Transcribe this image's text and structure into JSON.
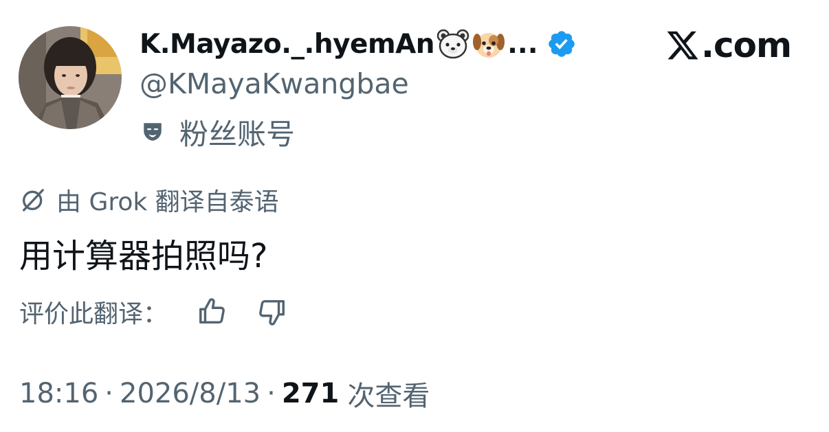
{
  "author": {
    "display_name": "K.Mayazo._.hyemAn",
    "name_emojis": [
      "polar-bear-face",
      "dog-face"
    ],
    "ellipsis": "...",
    "verified": true,
    "handle": "@KMayaKwangbae",
    "account_label": "粉丝账号"
  },
  "brand": {
    "label": ".com"
  },
  "translation": {
    "label": "由 Grok 翻译自泰语"
  },
  "tweet": {
    "text": "用计算器拍照吗?"
  },
  "rating": {
    "label": "评价此翻译："
  },
  "meta": {
    "time": "18:16",
    "date": "2026/8/13",
    "separator": "·",
    "views_count": "271",
    "views_label": "次查看"
  },
  "colors": {
    "primary_text": "#0f1419",
    "secondary_text": "#536471",
    "verified_blue": "#1d9bf0",
    "background": "#ffffff"
  },
  "icons": {
    "verified": "verified-badge-icon",
    "account_label": "theater-mask-icon",
    "translation": "grok-icon",
    "like_translation": "thumbs-up-icon",
    "dislike_translation": "thumbs-down-icon",
    "brand": "x-logo-icon"
  }
}
